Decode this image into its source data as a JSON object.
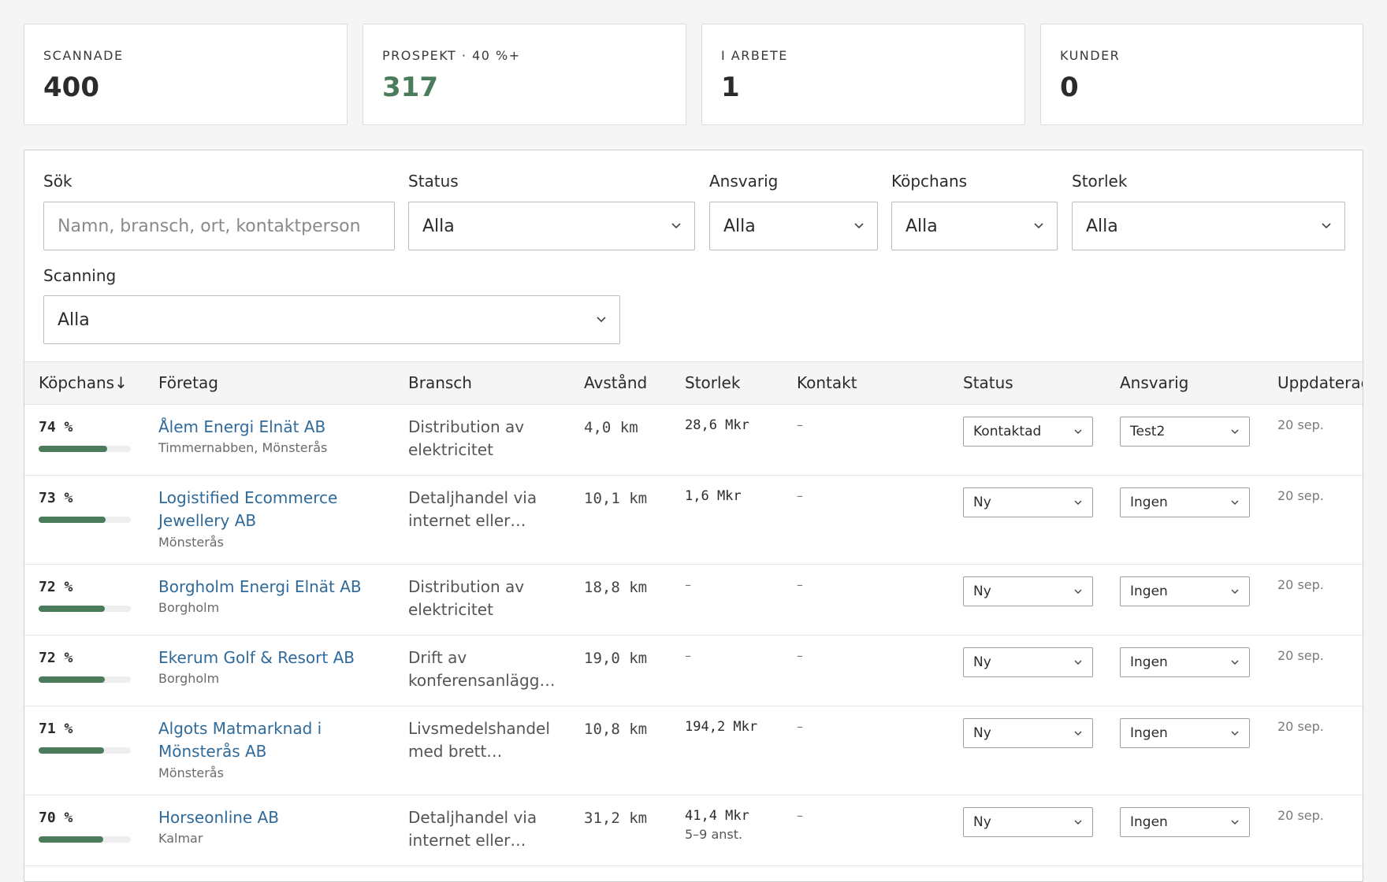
{
  "stats": [
    {
      "label": "SCANNADE",
      "value": "400"
    },
    {
      "label": "PROSPEKT · 40 %+",
      "value": "317"
    },
    {
      "label": "I ARBETE",
      "value": "1"
    },
    {
      "label": "KUNDER",
      "value": "0"
    }
  ],
  "accent_color": "#4a7c5c",
  "link_color": "#2f6a9a",
  "filters": {
    "search": {
      "label": "Sök",
      "placeholder": "Namn, bransch, ort, kontaktperson",
      "value": ""
    },
    "status": {
      "label": "Status",
      "value": "Alla"
    },
    "ansvarig": {
      "label": "Ansvarig",
      "value": "Alla"
    },
    "kopchans": {
      "label": "Köpchans",
      "value": "Alla"
    },
    "storlek": {
      "label": "Storlek",
      "value": "Alla"
    },
    "scanning": {
      "label": "Scanning",
      "value": "Alla"
    }
  },
  "table": {
    "headers": {
      "kopchans": "Köpchans↓",
      "foretag": "Företag",
      "bransch": "Bransch",
      "avstand": "Avstånd",
      "storlek": "Storlek",
      "kontakt": "Kontakt",
      "status": "Status",
      "ansvarig": "Ansvarig",
      "uppdaterad": "Uppdaterad"
    },
    "rows": [
      {
        "score": "74 %",
        "score_value": 0.74,
        "company": "Ålem Energi Elnät AB",
        "city": "Timmernabben, Mönsterås",
        "industry": "Distribution av elektricitet",
        "distance": "4,0 km",
        "size": "28,6 Mkr",
        "employees": "",
        "contact": "–",
        "status": "Kontaktad",
        "owner": "Test2",
        "updated": "20 sep."
      },
      {
        "score": "73 %",
        "score_value": 0.73,
        "company": "Logistified Ecommerce Jewellery AB",
        "city": "Mönsterås",
        "industry": "Detaljhandel via internet eller…",
        "distance": "10,1 km",
        "size": "1,6 Mkr",
        "employees": "",
        "contact": "–",
        "status": "Ny",
        "owner": "Ingen",
        "updated": "20 sep."
      },
      {
        "score": "72 %",
        "score_value": 0.72,
        "company": "Borgholm Energi Elnät AB",
        "city": "Borgholm",
        "industry": "Distribution av elektricitet",
        "distance": "18,8 km",
        "size": "–",
        "employees": "",
        "contact": "–",
        "status": "Ny",
        "owner": "Ingen",
        "updated": "20 sep."
      },
      {
        "score": "72 %",
        "score_value": 0.72,
        "company": "Ekerum Golf & Resort AB",
        "city": "Borgholm",
        "industry": "Drift av konferensanlägg…",
        "distance": "19,0 km",
        "size": "–",
        "employees": "",
        "contact": "–",
        "status": "Ny",
        "owner": "Ingen",
        "updated": "20 sep."
      },
      {
        "score": "71 %",
        "score_value": 0.71,
        "company": "Algots Matmarknad i Mönsterås AB",
        "city": "Mönsterås",
        "industry": "Livsmedelshandel med brett…",
        "distance": "10,8 km",
        "size": "194,2 Mkr",
        "employees": "",
        "contact": "–",
        "status": "Ny",
        "owner": "Ingen",
        "updated": "20 sep."
      },
      {
        "score": "70 %",
        "score_value": 0.7,
        "company": "Horseonline AB",
        "city": "Kalmar",
        "industry": "Detaljhandel via internet eller…",
        "distance": "31,2 km",
        "size": "41,4 Mkr",
        "employees": "5–9 anst.",
        "contact": "–",
        "status": "Ny",
        "owner": "Ingen",
        "updated": "20 sep."
      }
    ]
  }
}
